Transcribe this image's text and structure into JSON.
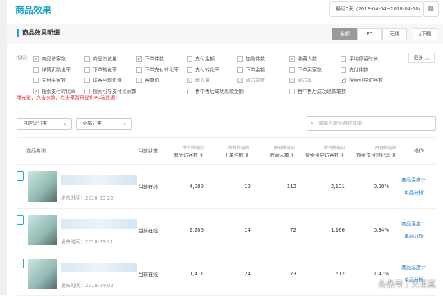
{
  "header": {
    "title": "商品效果",
    "date_range": "最近7天（2018-04-04~2018-04-10）",
    "calendar_icon": "calendar-icon"
  },
  "section": {
    "title": "商品效果明细",
    "tabs": [
      "全部",
      "PC",
      "无线"
    ],
    "download": "下载"
  },
  "metrics": {
    "label": "指标：",
    "more": "更多",
    "items": [
      {
        "label": "商品访客数",
        "checked": true
      },
      {
        "label": "商品浏览量",
        "checked": false
      },
      {
        "label": "下单件数",
        "checked": true
      },
      {
        "label": "支付金额",
        "checked": false
      },
      {
        "label": "加购件数",
        "checked": false
      },
      {
        "label": "收藏人数",
        "checked": true
      },
      {
        "label": "平均停留时长",
        "checked": false
      },
      {
        "label": "详情页跳出率",
        "checked": false
      },
      {
        "label": "下单转化率",
        "checked": false
      },
      {
        "label": "下单支付转化率",
        "checked": false
      },
      {
        "label": "支付转化率",
        "checked": false
      },
      {
        "label": "下单金额",
        "checked": false
      },
      {
        "label": "下单买家数",
        "checked": false
      },
      {
        "label": "支付件数",
        "checked": false
      },
      {
        "label": "支付买家数",
        "checked": false
      },
      {
        "label": "访客平均价值",
        "checked": false
      },
      {
        "label": "客单价",
        "checked": false
      },
      {
        "label": "曝光量",
        "checked": false,
        "disabled": true
      },
      {
        "label": "点击次数",
        "checked": false,
        "disabled": true
      },
      {
        "label": "点击率",
        "checked": false,
        "disabled": true
      },
      {
        "label": "搜索引导访客数",
        "checked": true
      },
      {
        "label": "搜索支付转化率",
        "checked": true
      },
      {
        "label": "搜索引导支付买家数",
        "checked": false
      },
      {
        "label": "售中售后成功退款金额",
        "checked": false
      },
      {
        "label": "售中售后成功退款笔数",
        "checked": false
      }
    ],
    "warning": "曝光量，点击次数，点击率暂只提供PC端数据！"
  },
  "filters": {
    "custom_category": "自定义分类",
    "all_category": "全部分类",
    "search_placeholder": "请输入商品名称或ID"
  },
  "table": {
    "prefix": "所有终端的",
    "headers": {
      "name": "商品名称",
      "status": "当前状态",
      "visitors": "商品访客数",
      "orders": "下单件数",
      "favorites": "收藏人数",
      "search_visitors": "搜索引导访客数",
      "search_conv": "搜索支付转化率",
      "action": "操作"
    },
    "rows": [
      {
        "published": "发布时间：2018-03-22",
        "status": "当前在线",
        "visitors": "4,089",
        "orders": "19",
        "favorites": "113",
        "search_visitors": "2,131",
        "search_conv": "0.38%",
        "link1": "商品温度计",
        "link2": "单品分析"
      },
      {
        "published": "发布时间：2018-03-21",
        "status": "当前在线",
        "visitors": "2,206",
        "orders": "14",
        "favorites": "72",
        "search_visitors": "1,166",
        "search_conv": "0.34%",
        "link1": "商品温度计",
        "link2": "单品分析"
      },
      {
        "published": "发布时间：2018-04-02",
        "status": "当前在线",
        "visitors": "1,411",
        "orders": "24",
        "favorites": "73",
        "search_visitors": "612",
        "search_conv": "1.47%",
        "link1": "商品温度计",
        "link2": "单品分析"
      }
    ]
  },
  "watermark": "头条号 / 大王真"
}
